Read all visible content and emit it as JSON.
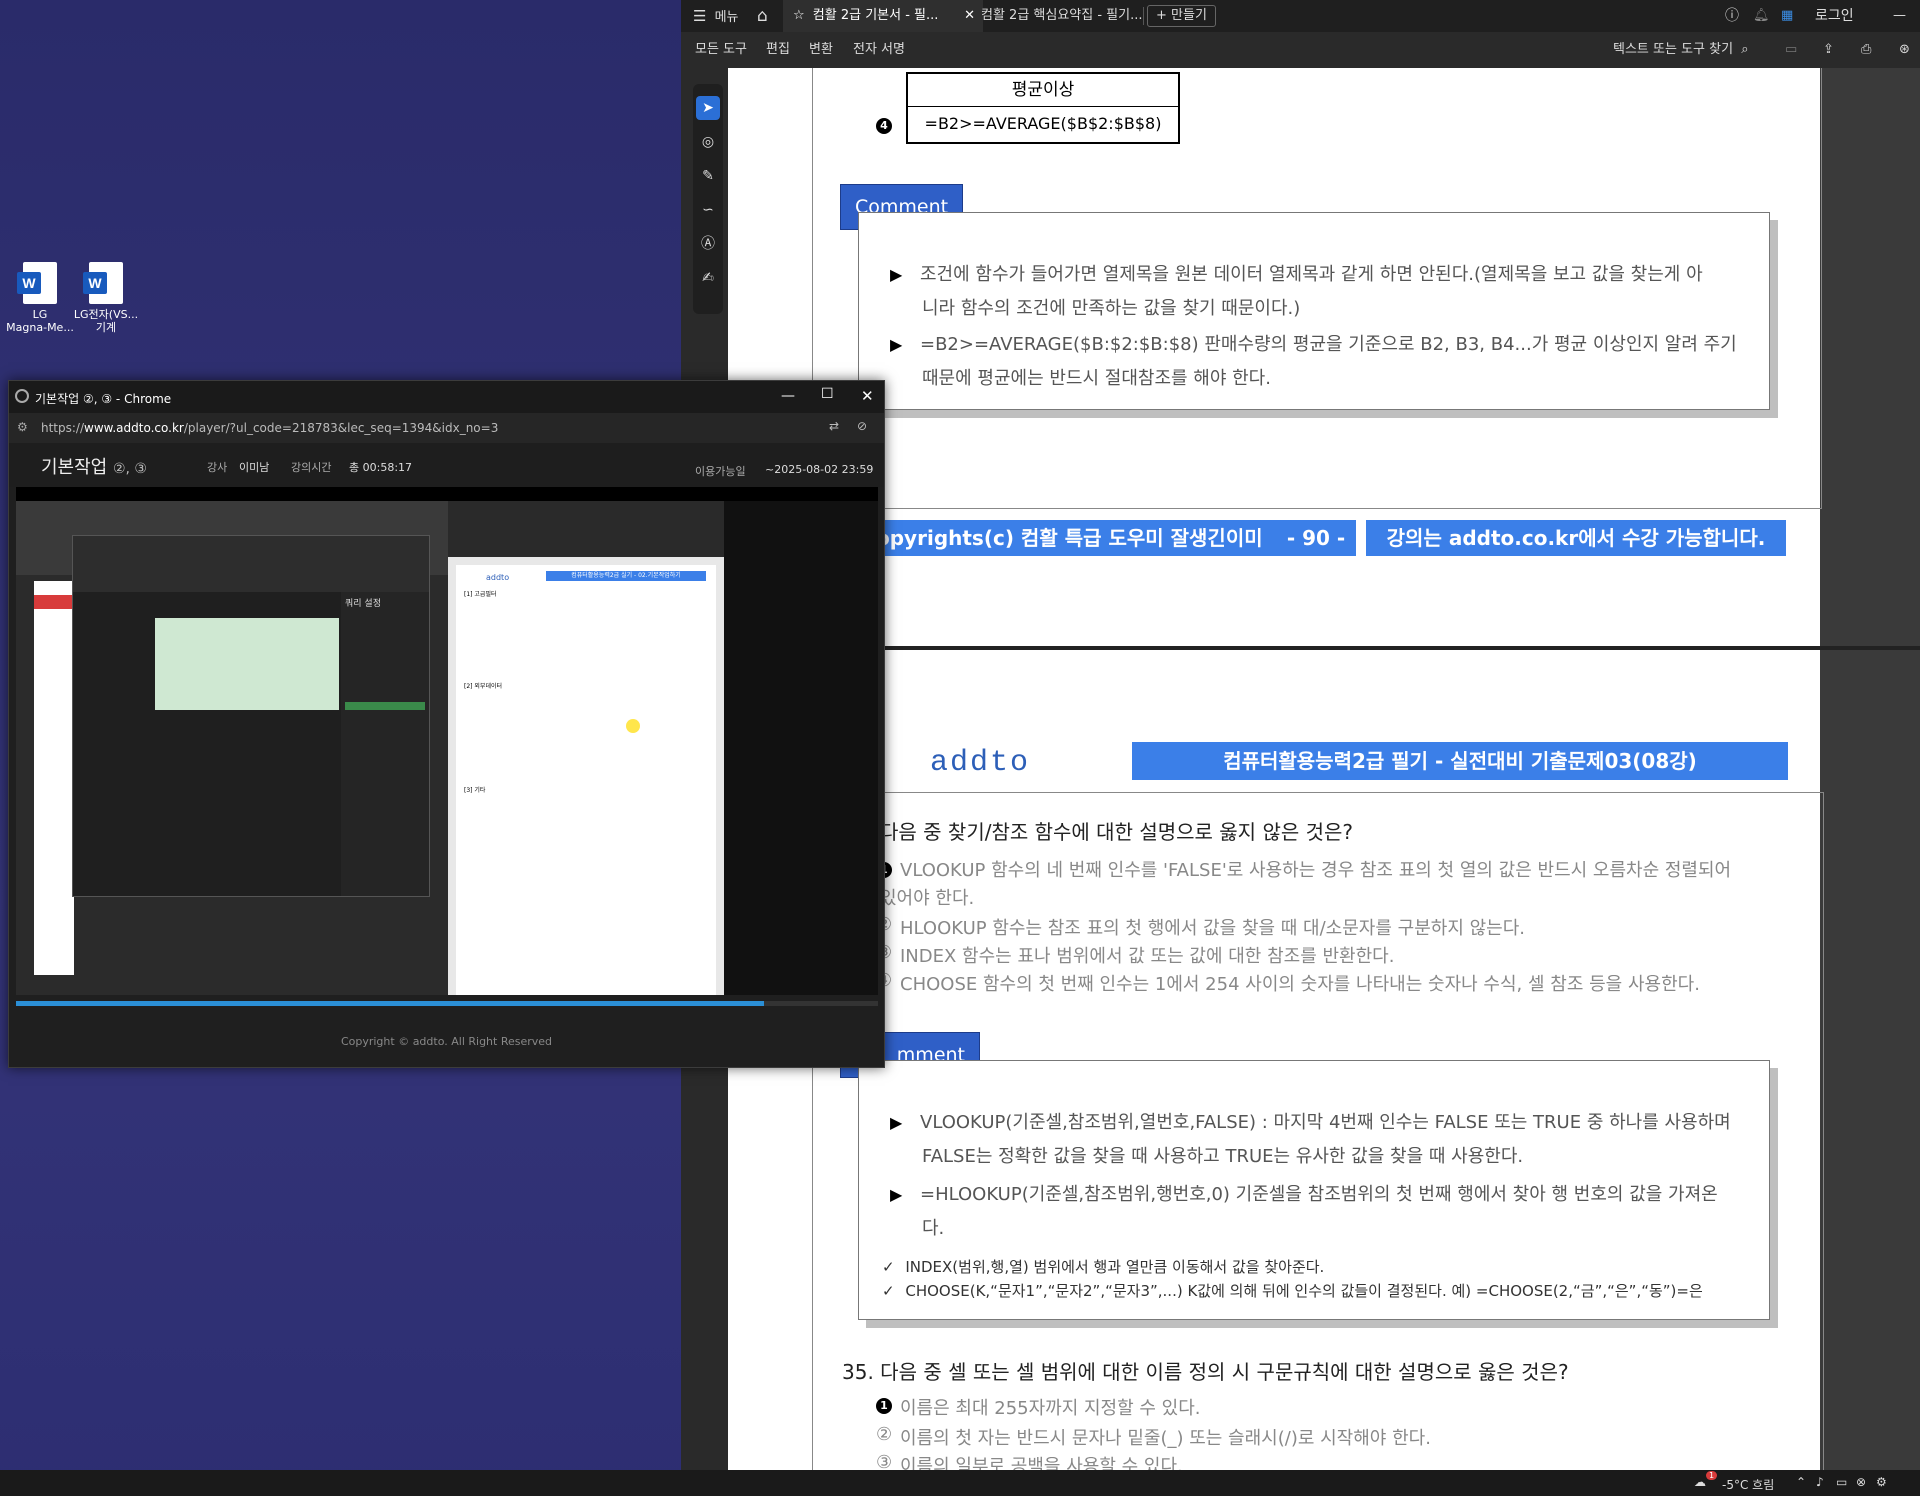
{
  "desktop": {
    "icons": [
      {
        "label_line1": "LG",
        "label_line2": "Magna-Me..."
      },
      {
        "label_line1": "LG전자(VS...",
        "label_line2": "기계"
      }
    ]
  },
  "acrobat": {
    "tabs": {
      "menu": "메뉴",
      "tab1": "컴활 2급 기본서 - 필...",
      "tab2": "컴활 2급 핵심요약집 - 필기...",
      "new_tab": "만들기",
      "login": "로그인"
    },
    "toolbar": {
      "all_tools": "모든 도구",
      "edit": "편집",
      "convert": "변환",
      "e_sign": "전자 서명",
      "search": "텍스트 또는 도구 찾기"
    }
  },
  "pdf": {
    "formula_box": {
      "header": "평균이상",
      "body": "=B2>=AVERAGE($B$2:$B$8)"
    },
    "formula_marker": "4",
    "comment1": {
      "tag": "Comment",
      "line1": "조건에 함수가 들어가면 열제목을 원본 데이터 열제목과 같게 하면 안된다.(열제목을 보고 값을 찾는게 아",
      "line1b": "니라 함수의 조건에 만족하는 값을 찾기 때문이다.)",
      "line2": "=B2>=AVERAGE($B:$2:$B:$8) 판매수량의 평균을 기준으로 B2, B3, B4...가 평균 이상인지 알려 주기",
      "line2b": "때문에 평균에는 반드시 절대참조를 해야 한다."
    },
    "footer": {
      "copyright": "opyrights(c) 컴활 특급 도우미 잘생긴이미남",
      "page_no": "- 90 -",
      "notice": "강의는 addto.co.kr에서 수강 가능합니다."
    },
    "page2_header": {
      "logo": "addto",
      "title": "컴퓨터활용능력2급 필기 - 실전대비 기출문제03(08강)"
    },
    "q34": {
      "title": "다음 중 찾기/참조 함수에 대한 설명으로 옳지 않은 것은?",
      "opt1a": "VLOOKUP 함수의 네 번째 인수를 'FALSE'로 사용하는 경우 참조 표의 첫 열의 값은 반드시 오름차순 정렬되어",
      "opt1b": "있어야 한다.",
      "opt2": "HLOOKUP 함수는 참조 표의 첫 행에서 값을 찾을 때 대/소문자를 구분하지 않는다.",
      "opt3": "INDEX 함수는 표나 범위에서 값 또는 값에 대한 참조를 반환한다.",
      "opt4": "CHOOSE 함수의 첫 번째 인수는 1에서 254 사이의 숫자를 나타내는 숫자나 수식, 셀 참조 등을 사용한다."
    },
    "comment2": {
      "tag": "mment",
      "line1": "VLOOKUP(기준셀,참조범위,열번호,FALSE) : 마지막 4번째 인수는 FALSE 또는 TRUE 중 하나를 사용하며",
      "line1b": "FALSE는 정확한 값을 찾을 때 사용하고 TRUE는 유사한 값을 찾을 때 사용한다.",
      "line2": "=HLOOKUP(기준셀,참조범위,행번호,0) 기준셀을 참조범위의 첫 번째 행에서 찾아 행 번호의 값을 가져온",
      "line2b": "다.",
      "check1": "INDEX(범위,행,열) 범위에서 행과 열만큼 이동해서 값을 찾아준다.",
      "check2": "CHOOSE(K,“문자1”,“문자2”,“문자3”,...) K값에 의해 뒤에 인수의 값들이 결정된다. 예) =CHOOSE(2,“금”,“은”,“동”)=은"
    },
    "q35": {
      "title": "35. 다음 중 셀 또는 셀 범위에 대한 이름 정의 시 구문규칙에 대한 설명으로 옳은 것은?",
      "opt1": "이름은 최대 255자까지 지정할 수 있다.",
      "opt2": "이름의 첫 자는 반드시 문자나 밑줄(_) 또는 슬래시(/)로 시작해야 한다.",
      "opt3": "이름의 일부로 공백을 사용할 수 있다."
    }
  },
  "chrome": {
    "title": "기본작업 ②, ③ - Chrome",
    "url_prefix": "https://",
    "url_domain": "www.addto.co.kr",
    "url_path": "/player/?ul_code=218783&lec_seq=1394&idx_no=3",
    "player": {
      "title": "기본작업",
      "title_suffix": "②, ③",
      "instructor_label": "강사",
      "instructor": "이미남",
      "time_label": "강의시간",
      "time_value": "총 00:58:17",
      "avail_label": "이용가능일",
      "avail_value": "~2025-08-02 23:59"
    },
    "progress": 0.868,
    "footer": "Copyright © addto. All Right Reserved",
    "video": {
      "pq_title": "쿼리 설정",
      "pdf_heading": "컴퓨터활용능력2급 실기 - 02.기본작업하기",
      "pdf_logo": "addto",
      "sec1": "[1] 고급필터",
      "sec2": "[2] 외부데이터",
      "sec3": "[3] 기타"
    }
  },
  "taskbar": {
    "weather": "-5°C 흐림",
    "badge": "1"
  },
  "colors": {
    "accent_blue": "#3b7fe8",
    "comment_blue": "#2f5fc7",
    "progress": "#2b8fd6"
  }
}
